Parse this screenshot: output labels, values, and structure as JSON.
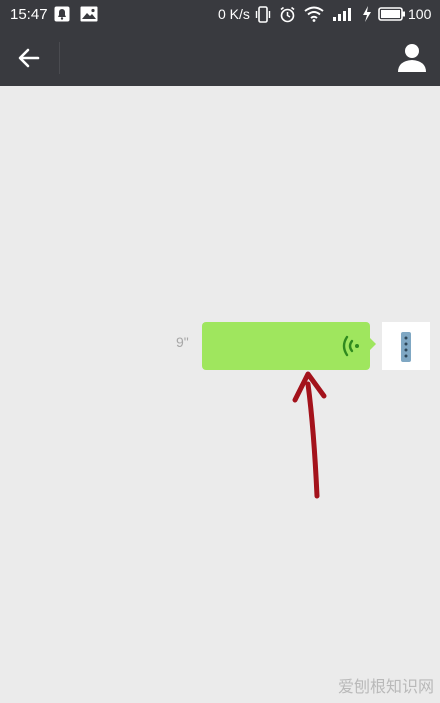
{
  "status_bar": {
    "time": "15:47",
    "net_speed": "0 K/s",
    "battery": "100",
    "icons": [
      "notification-icon",
      "image-icon",
      "vibrate-icon",
      "alarm-icon",
      "wifi-icon",
      "signal-icon",
      "charging-icon",
      "battery-icon"
    ]
  },
  "title_bar": {
    "icons": [
      "back-arrow-icon",
      "profile-icon"
    ]
  },
  "message": {
    "duration": "9\"",
    "type": "voice",
    "icon": "voice-wave-icon",
    "bubble_color": "#9fe65e"
  },
  "avatar": {
    "icon": "phone-icon"
  },
  "annotation": {
    "icon": "red-arrow-icon",
    "color": "#a3121b"
  },
  "watermark": "爱刨根知识网",
  "colors": {
    "header": "#393a3f",
    "background": "#ebebeb"
  }
}
